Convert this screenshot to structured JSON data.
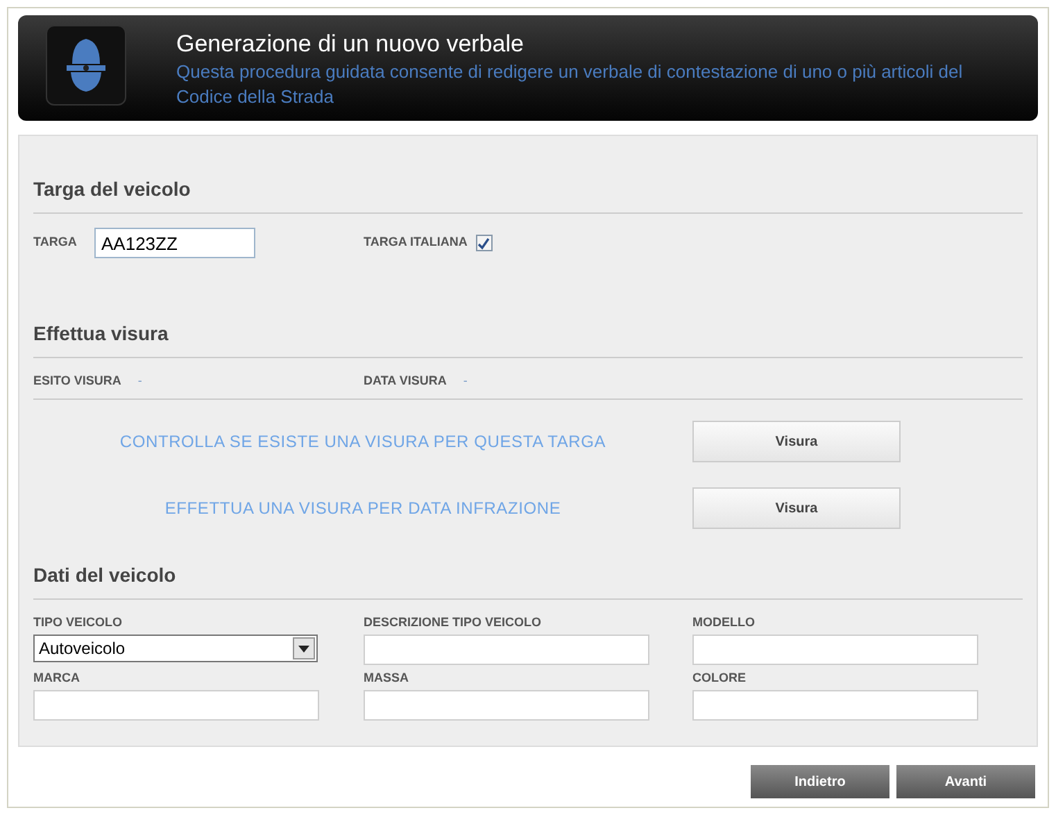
{
  "header": {
    "title": "Generazione di un nuovo verbale",
    "subtitle": "Questa procedura guidata consente di redigere un verbale di contestazione di uno o più articoli del Codice della Strada"
  },
  "targa_section": {
    "title": "Targa del veicolo",
    "plate": {
      "label": "TARGA",
      "value": "AA123ZZ"
    },
    "italian": {
      "label": "TARGA ITALIANA",
      "checked": true
    }
  },
  "visura_section": {
    "title": "Effettua visura",
    "info": [
      {
        "label": "ESITO VISURA",
        "value": "-"
      },
      {
        "label": "DATA VISURA",
        "value": "-"
      }
    ],
    "actions": [
      {
        "text": "CONTROLLA SE ESISTE UNA VISURA PER QUESTA TARGA",
        "button": "Visura"
      },
      {
        "text": "EFFETTUA UNA VISURA PER DATA INFRAZIONE",
        "button": "Visura"
      }
    ]
  },
  "vehicle_section": {
    "title": "Dati del veicolo",
    "fields": [
      {
        "label": "TIPO VEICOLO",
        "kind": "select",
        "value": "Autoveicolo"
      },
      {
        "label": "DESCRIZIONE TIPO VEICOLO",
        "kind": "text"
      },
      {
        "label": "MODELLO",
        "kind": "text"
      },
      {
        "label": "MARCA",
        "kind": "text"
      },
      {
        "label": "MASSA",
        "kind": "text"
      },
      {
        "label": "COLORE",
        "kind": "text"
      }
    ]
  },
  "nav_buttons": [
    "Indietro",
    "Avanti"
  ]
}
